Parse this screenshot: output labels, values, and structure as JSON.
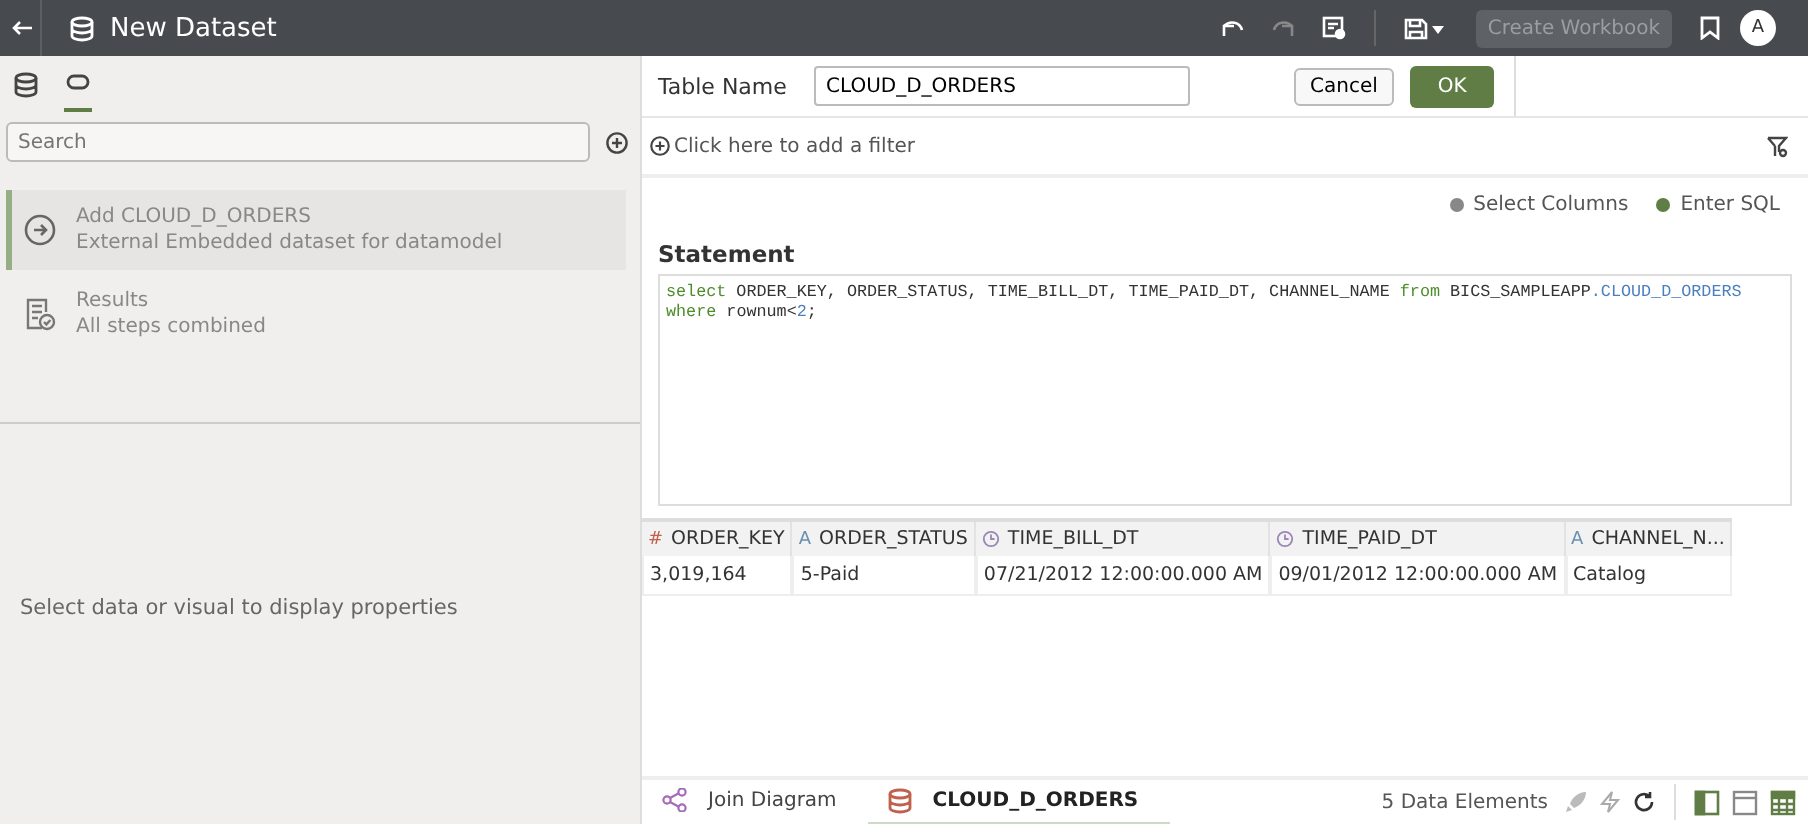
{
  "header": {
    "title": "New Dataset",
    "create_workbook": {
      "label": "Create Workbook",
      "disabled": true
    },
    "avatar": "A"
  },
  "left": {
    "tabs": [
      {
        "kind": "database",
        "selected": false
      },
      {
        "kind": "sql",
        "selected": true
      }
    ],
    "search": {
      "placeholder": "Search"
    },
    "steps": [
      {
        "kind": "add",
        "title": "Add CLOUD_D_ORDERS",
        "subtitle": "External Embedded dataset for datamodel",
        "selected": true
      },
      {
        "kind": "results",
        "title": "Results",
        "subtitle": "All steps combined",
        "selected": false
      }
    ],
    "properties_hint": "Select data or visual to display properties"
  },
  "editor": {
    "table_name_label": "Table Name",
    "table_name": "CLOUD_D_ORDERS",
    "cancel": "Cancel",
    "ok": "OK",
    "filter_hint": "Click here to add a filter",
    "modes": [
      {
        "label": "Select Columns",
        "selected": false
      },
      {
        "label": "Enter SQL",
        "selected": true
      }
    ],
    "statement_label": "Statement",
    "sql_lines": [
      [
        {
          "kind": "keyword",
          "text": "select"
        },
        {
          "kind": "plain",
          "text": " ORDER_KEY, ORDER_STATUS, TIME_BILL_DT, TIME_PAID_DT, CHANNEL_NAME "
        },
        {
          "kind": "keyword",
          "text": "from"
        },
        {
          "kind": "plain",
          "text": " BICS_SAMPLEAPP"
        },
        {
          "kind": "name",
          "text": ".CLOUD_D_ORDERS"
        }
      ],
      [
        {
          "kind": "keyword",
          "text": "where"
        },
        {
          "kind": "plain",
          "text": " rownum<"
        },
        {
          "kind": "name",
          "text": "2"
        },
        {
          "kind": "plain",
          "text": ";"
        }
      ]
    ]
  },
  "table": {
    "columns": [
      {
        "kind": "number",
        "icon": "#",
        "name": "ORDER_KEY"
      },
      {
        "kind": "text",
        "icon": "A",
        "name": "ORDER_STATUS"
      },
      {
        "kind": "datetime",
        "name": "TIME_BILL_DT"
      },
      {
        "kind": "datetime",
        "name": "TIME_PAID_DT"
      },
      {
        "kind": "text",
        "icon": "A",
        "name": "CHANNEL_N..."
      }
    ],
    "rows": [
      [
        "3,019,164",
        "5-Paid",
        "07/21/2012 12:00:00.000 AM",
        "09/01/2012 12:00:00.000 AM",
        "Catalog"
      ]
    ]
  },
  "bottom": {
    "tabs": [
      {
        "kind": "diagram",
        "label": "Join Diagram",
        "selected": false
      },
      {
        "kind": "database",
        "label": "CLOUD_D_ORDERS",
        "selected": true
      }
    ],
    "element_count": "5 Data Elements"
  }
}
